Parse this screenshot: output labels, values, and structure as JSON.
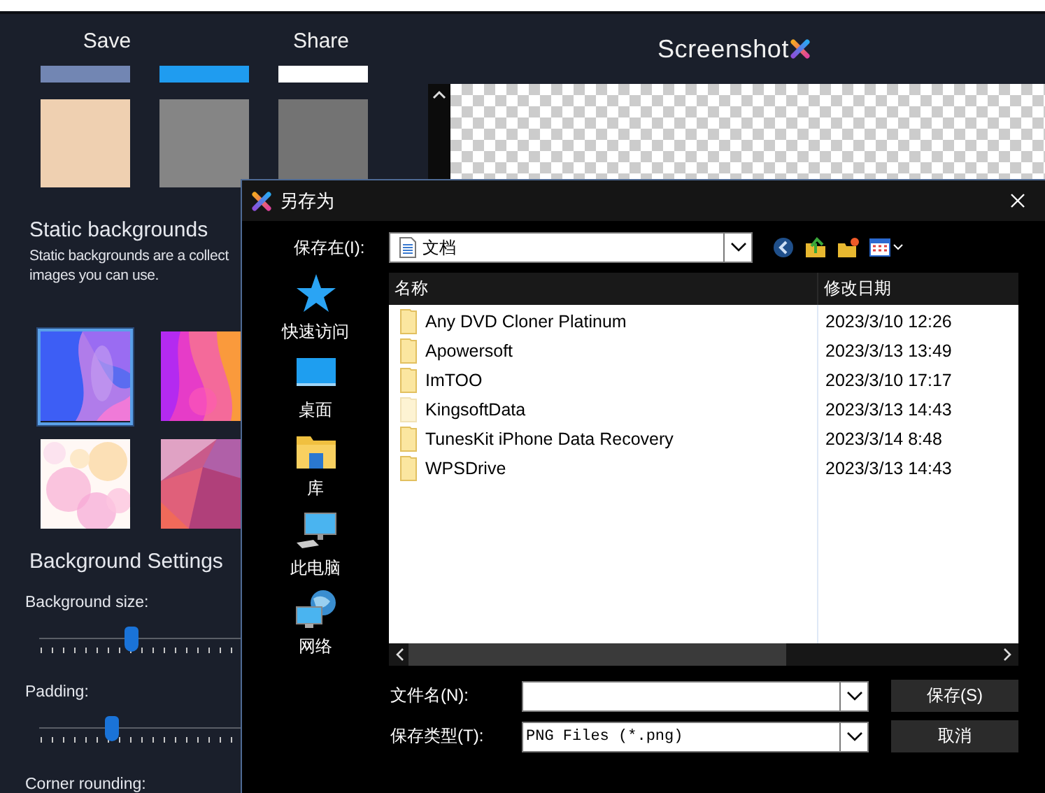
{
  "app": {
    "header": {
      "save": "Save",
      "share": "Share",
      "logo": "Screenshot"
    },
    "swatch_bars": [
      {
        "color": "#7286b3"
      },
      {
        "color": "#1f9cf0"
      },
      {
        "color": "#ffffff"
      }
    ],
    "swatches": [
      {
        "color": "#efd0b1"
      },
      {
        "color": "#858585"
      },
      {
        "color": "#737373"
      }
    ],
    "static_backgrounds": {
      "title": "Static backgrounds",
      "description_lines": [
        "Static backgrounds are a collect",
        "images you can use."
      ],
      "thumbnails": [
        {
          "kind": "picture",
          "selected": true
        },
        {
          "kind": "picture",
          "selected": false
        },
        {
          "kind": "picture",
          "selected": false
        },
        {
          "kind": "picture",
          "selected": false
        }
      ]
    },
    "settings": {
      "title": "Background Settings",
      "sliders": [
        {
          "label": "Background size:",
          "level": 0.25
        },
        {
          "label": "Padding:",
          "level": 0.2
        }
      ],
      "next_label": "Corner rounding:"
    }
  },
  "dialog": {
    "title": "另存为",
    "save_in": {
      "label": "保存在(I):",
      "value": "文档"
    },
    "places": [
      {
        "kind": "quick",
        "label": "快速访问"
      },
      {
        "kind": "desktop",
        "label": "桌面"
      },
      {
        "kind": "library",
        "label": "库"
      },
      {
        "kind": "computer",
        "label": "此电脑"
      },
      {
        "kind": "network",
        "label": "网络"
      }
    ],
    "columns": [
      "名称",
      "修改日期"
    ],
    "rows": [
      {
        "name": "Any DVD Cloner Platinum",
        "date": "2023/3/10 12:26",
        "hidden": false
      },
      {
        "name": "Apowersoft",
        "date": "2023/3/13 13:49",
        "hidden": false
      },
      {
        "name": "ImTOO",
        "date": "2023/3/10 17:17",
        "hidden": false
      },
      {
        "name": "KingsoftData",
        "date": "2023/3/13 14:43",
        "hidden": true
      },
      {
        "name": "TunesKit iPhone Data Recovery",
        "date": "2023/3/14 8:48",
        "hidden": false
      },
      {
        "name": "WPSDrive",
        "date": "2023/3/13 14:43",
        "hidden": false
      }
    ],
    "file_name": {
      "label": "文件名(N):"
    },
    "file_type": {
      "label": "保存类型(T):",
      "value": "PNG Files (*.png)"
    },
    "buttons": [
      "保存(S)",
      "取消"
    ]
  }
}
